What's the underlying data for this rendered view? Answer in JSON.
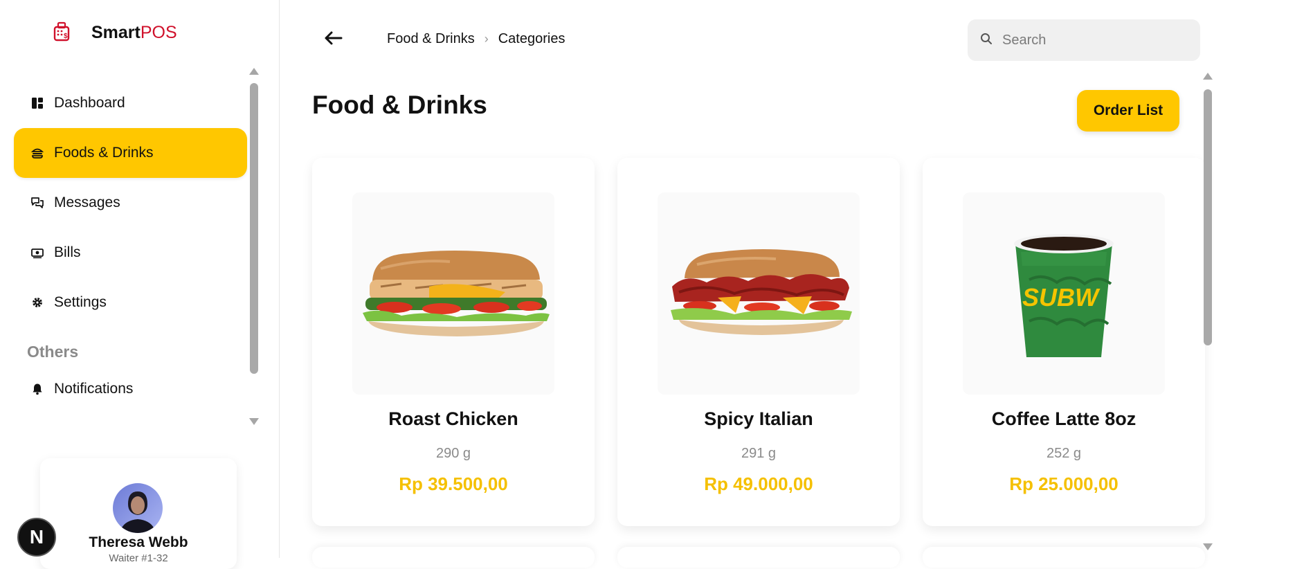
{
  "app": {
    "brand_strong": "Smart",
    "brand_accent": "POS",
    "accent_color": "#ffc700",
    "brand_color": "#d0112b"
  },
  "sidebar": {
    "items": [
      {
        "label": "Dashboard",
        "icon": "dashboard-icon",
        "active": false
      },
      {
        "label": "Foods & Drinks",
        "icon": "burger-icon",
        "active": true
      },
      {
        "label": "Messages",
        "icon": "messages-icon",
        "active": false
      },
      {
        "label": "Bills",
        "icon": "bills-icon",
        "active": false
      },
      {
        "label": "Settings",
        "icon": "gear-icon",
        "active": false
      }
    ],
    "others_title": "Others",
    "others_items": [
      {
        "label": "Notifications",
        "icon": "bell-icon"
      }
    ],
    "profile": {
      "name": "Theresa Webb",
      "role": "Waiter #1-32"
    },
    "framework_badge": "N"
  },
  "header": {
    "breadcrumb": [
      "Food & Drinks",
      "Categories"
    ],
    "search_placeholder": "Search"
  },
  "main": {
    "title": "Food & Drinks",
    "order_button": "Order List",
    "products": [
      {
        "name": "Roast Chicken",
        "weight": "290 g",
        "price": "Rp 39.500,00",
        "icon": "sandwich-chicken-image"
      },
      {
        "name": "Spicy Italian",
        "weight": "291 g",
        "price": "Rp 49.000,00",
        "icon": "sandwich-italian-image"
      },
      {
        "name": "Coffee Latte 8oz",
        "weight": "252 g",
        "price": "Rp 25.000,00",
        "icon": "coffee-cup-image"
      }
    ]
  }
}
